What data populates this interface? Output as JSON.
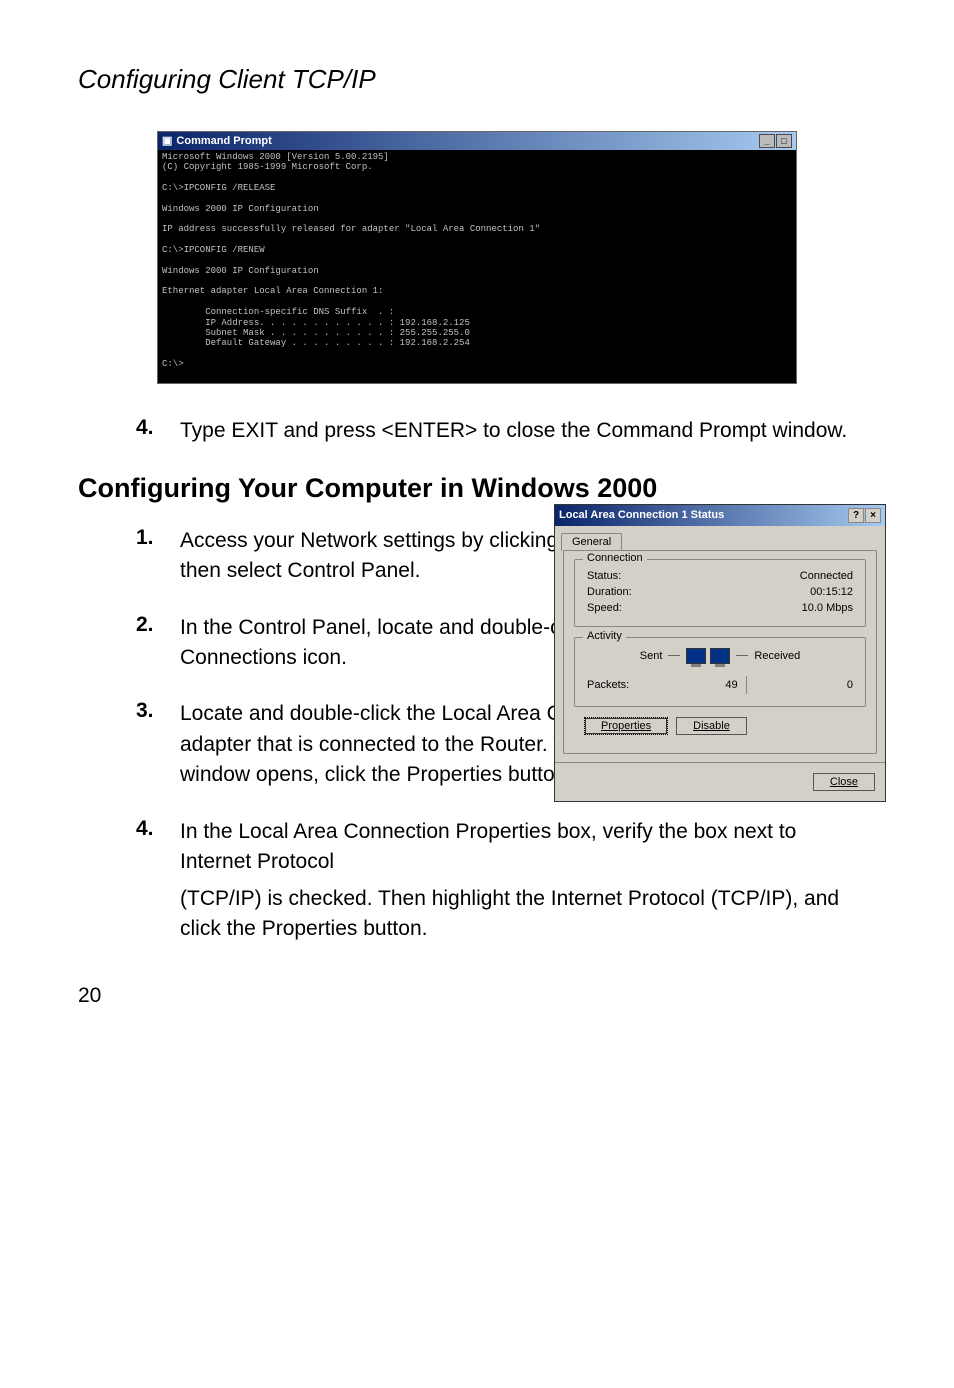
{
  "running_head": "Configuring Client TCP/IP",
  "cmd": {
    "title": "Command Prompt",
    "lines": "Microsoft Windows 2000 [Version 5.00.2195]\n(C) Copyright 1985-1999 Microsoft Corp.\n\nC:\\>IPCONFIG /RELEASE\n\nWindows 2000 IP Configuration\n\nIP address successfully released for adapter \"Local Area Connection 1\"\n\nC:\\>IPCONFIG /RENEW\n\nWindows 2000 IP Configuration\n\nEthernet adapter Local Area Connection 1:\n\n        Connection-specific DNS Suffix  . :\n        IP Address. . . . . . . . . . . . : 192.168.2.125\n        Subnet Mask . . . . . . . . . . . : 255.255.255.0\n        Default Gateway . . . . . . . . . : 192.168.2.254\n\nC:\\>"
  },
  "pre_steps": {
    "s4": {
      "num": "4.",
      "text": "Type EXIT and press <ENTER> to close the Command Prompt window."
    }
  },
  "heading": "Configuring Your Computer in Windows 2000",
  "steps": {
    "s1": {
      "num": "1.",
      "text": "Access your Network settings by clicking Start, then choose Settings and then select Control Panel."
    },
    "s2": {
      "num": "2.",
      "text": "In the Control Panel, locate and double-click the Network and Dial-up Connections icon."
    },
    "s3": {
      "num": "3.",
      "text": "Locate and double-click the Local Area Connection icon for the Ethernet adapter that is connected to the Router. When the Status dialog box window opens, click the Properties button."
    },
    "s4": {
      "num": "4.",
      "text_a": "In the Local Area Connection Properties box, verify the box next to Internet Protocol",
      "text_b": "(TCP/IP) is checked. Then highlight the Internet Protocol (TCP/IP), and click the Properties button."
    }
  },
  "dialog": {
    "title": "Local Area Connection 1 Status",
    "tab": "General",
    "connection": {
      "legend": "Connection",
      "status_label": "Status:",
      "status_value": "Connected",
      "duration_label": "Duration:",
      "duration_value": "00:15:12",
      "speed_label": "Speed:",
      "speed_value": "10.0 Mbps"
    },
    "activity": {
      "legend": "Activity",
      "sent": "Sent",
      "received": "Received",
      "packets_label": "Packets:",
      "packets_sent": "49",
      "packets_recv": "0"
    },
    "buttons": {
      "properties": "Properties",
      "disable": "Disable",
      "close": "Close"
    }
  },
  "page_number": "20"
}
